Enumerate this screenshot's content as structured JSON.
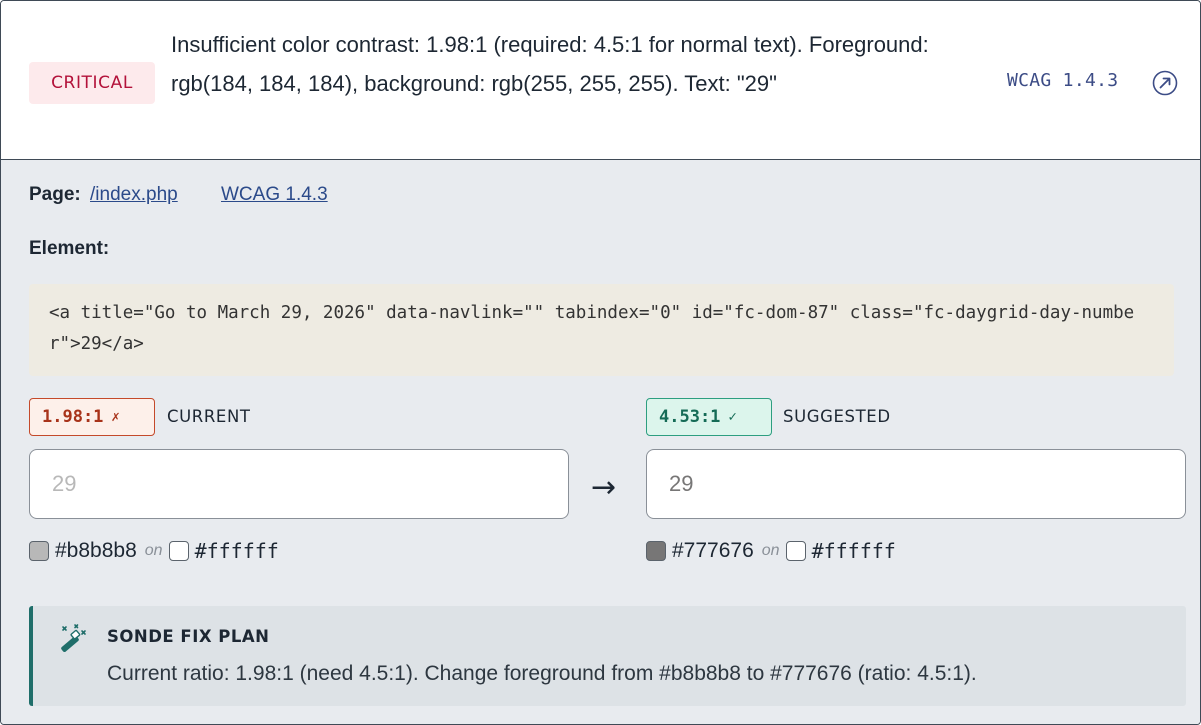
{
  "issue": {
    "severity": "CRITICAL",
    "description": "Insufficient color contrast: 1.98:1 (required: 4.5:1 for normal text). Foreground: rgb(184, 184, 184), background: rgb(255, 255, 255). Text: \"29\"",
    "wcag_ref": "WCAG 1.4.3",
    "link_icon": "external-link-icon"
  },
  "details": {
    "page_label": "Page:",
    "page_link": "/index.php",
    "wcag_link": "WCAG 1.4.3",
    "element_label": "Element:",
    "element_code": "<a title=\"Go to March 29, 2026\" data-navlink=\"\" tabindex=\"0\" id=\"fc-dom-87\" class=\"fc-daygrid-day-number\">29</a>"
  },
  "current": {
    "ratio": "1.98:1",
    "mark": "✗",
    "label": "CURRENT",
    "sample_text": "29",
    "fg_hex": "#b8b8b8",
    "on_word": "on",
    "bg_hex": "#ffffff",
    "fg_color": "#b8b8b8",
    "bg_color": "#ffffff"
  },
  "arrow": "→",
  "suggested": {
    "ratio": "4.53:1",
    "mark": "✓",
    "label": "SUGGESTED",
    "sample_text": "29",
    "fg_hex": "#777676",
    "on_word": "on",
    "bg_hex": "#ffffff",
    "fg_color": "#777676",
    "bg_color": "#ffffff"
  },
  "fix_plan": {
    "icon": "magic-wand-icon",
    "title": "SONDE FIX PLAN",
    "text": "Current ratio: 1.98:1 (need 4.5:1). Change foreground from #b8b8b8 to #777676 (ratio: 4.5:1)."
  },
  "colors": {
    "critical": "#b3123a",
    "accent": "#1f6e6a",
    "link": "#2b4a8a"
  }
}
